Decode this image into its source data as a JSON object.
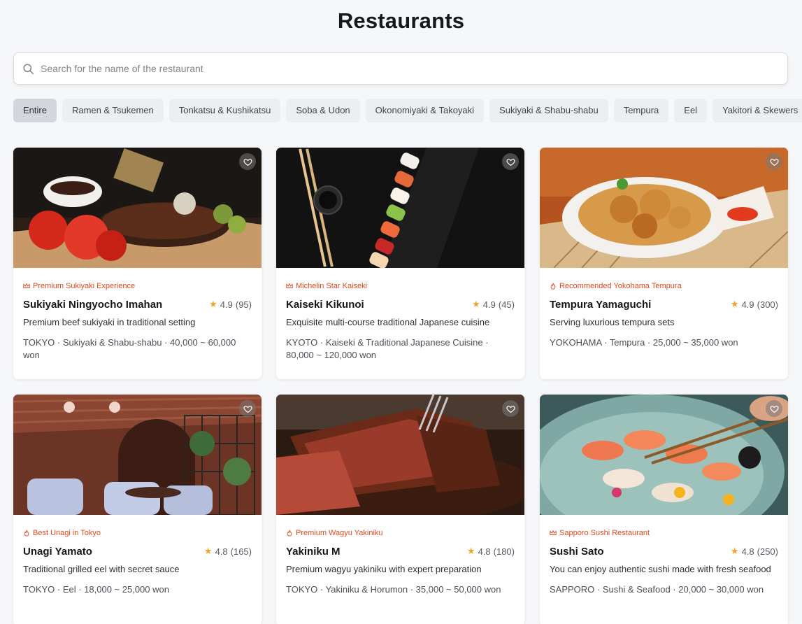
{
  "page": {
    "title": "Restaurants"
  },
  "search": {
    "placeholder": "Search for the name of the restaurant",
    "value": ""
  },
  "categories": [
    "Entire",
    "Ramen & Tsukemen",
    "Tonkatsu & Kushikatsu",
    "Soba & Udon",
    "Okonomiyaki & Takoyaki",
    "Sukiyaki & Shabu-shabu",
    "Tempura",
    "Eel",
    "Yakitori & Skewers"
  ],
  "active_category": "Entire",
  "restaurants": [
    {
      "badge": "Premium Sukiyaki Experience",
      "badge_icon": "crown-icon",
      "name": "Sukiyaki Ningyocho Imahan",
      "rating": "4.9",
      "reviews": "(95)",
      "description": "Premium beef sukiyaki in traditional setting",
      "meta": "TOKYO · Sukiyaki & Shabu-shabu · 40,000 ~ 60,000 won",
      "image": "grilled-ribs-photo",
      "favorited": false
    },
    {
      "badge": "Michelin Star Kaiseki",
      "badge_icon": "crown-icon",
      "name": "Kaiseki Kikunoi",
      "rating": "4.9",
      "reviews": "(45)",
      "description": "Exquisite multi-course traditional Japanese cuisine",
      "meta": "KYOTO · Kaiseki & Traditional Japanese Cuisine · 80,000 ~ 120,000 won",
      "image": "sushi-platter-photo",
      "favorited": false
    },
    {
      "badge": "Recommended Yokohama Tempura",
      "badge_icon": "fire-icon",
      "name": "Tempura Yamaguchi",
      "rating": "4.9",
      "reviews": "(300)",
      "description": "Serving luxurious tempura sets",
      "meta": "YOKOHAMA · Tempura · 25,000 ~ 35,000 won",
      "image": "tempura-plate-photo",
      "favorited": false
    },
    {
      "badge": "Best Unagi in Tokyo",
      "badge_icon": "fire-icon",
      "name": "Unagi Yamato",
      "rating": "4.8",
      "reviews": "(165)",
      "description": "Traditional grilled eel with secret sauce",
      "meta": "TOKYO · Eel · 18,000 ~ 25,000 won",
      "image": "restaurant-interior-photo",
      "favorited": false
    },
    {
      "badge": "Premium Wagyu Yakiniku",
      "badge_icon": "fire-icon",
      "name": "Yakiniku M",
      "rating": "4.8",
      "reviews": "(180)",
      "description": "Premium wagyu yakiniku with expert preparation",
      "meta": "TOKYO · Yakiniku & Horumon · 35,000 ~ 50,000 won",
      "image": "sliced-steak-photo",
      "favorited": false
    },
    {
      "badge": "Sapporo Sushi Restaurant",
      "badge_icon": "crown-icon",
      "name": "Sushi Sato",
      "rating": "4.8",
      "reviews": "(250)",
      "description": "You can enjoy authentic sushi made with fresh seafood",
      "meta": "SAPPORO · Sushi & Seafood · 20,000 ~ 30,000 won",
      "image": "sashimi-plate-photo",
      "favorited": false
    }
  ],
  "colors": {
    "accent": "#e0481e",
    "star": "#f0a22a",
    "background": "#f6f7f9"
  }
}
